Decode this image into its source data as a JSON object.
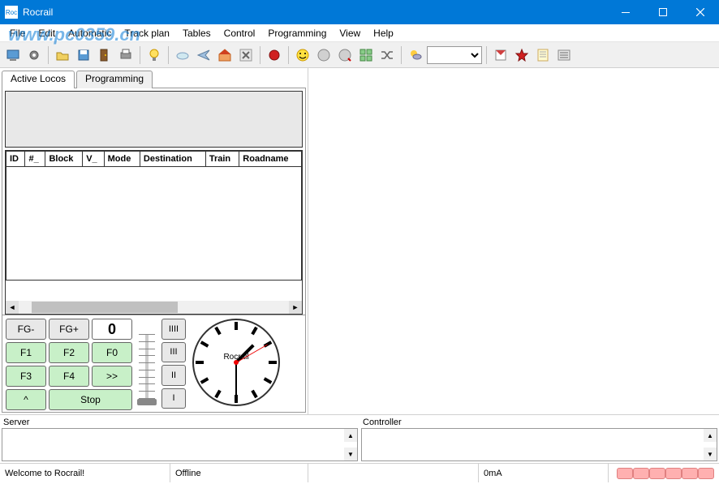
{
  "window": {
    "title": "Rocrail",
    "icon_label": "Roc"
  },
  "menu": [
    "File",
    "Edit",
    "Automatic",
    "Track plan",
    "Tables",
    "Control",
    "Programming",
    "View",
    "Help"
  ],
  "watermark": "www.pc0359.cn",
  "tabs": {
    "active": "Active Locos",
    "other": "Programming"
  },
  "table_headers": [
    "ID",
    "#_",
    "Block",
    "V_",
    "Mode",
    "Destination",
    "Train",
    "Roadname"
  ],
  "controls": {
    "fg_minus": "FG-",
    "fg_plus": "FG+",
    "speed": "0",
    "f1": "F1",
    "f2": "F2",
    "f0": "F0",
    "f3": "F3",
    "f4": "F4",
    "ff": ">>",
    "up": "^",
    "stop": "Stop",
    "i4": "IIII",
    "i3": "III",
    "i2": "II",
    "i1": "I"
  },
  "clock_label": "Rocrail",
  "log": {
    "server": "Server",
    "controller": "Controller"
  },
  "status": {
    "welcome": "Welcome to Rocrail!",
    "conn": "Offline",
    "current": "0mA"
  }
}
